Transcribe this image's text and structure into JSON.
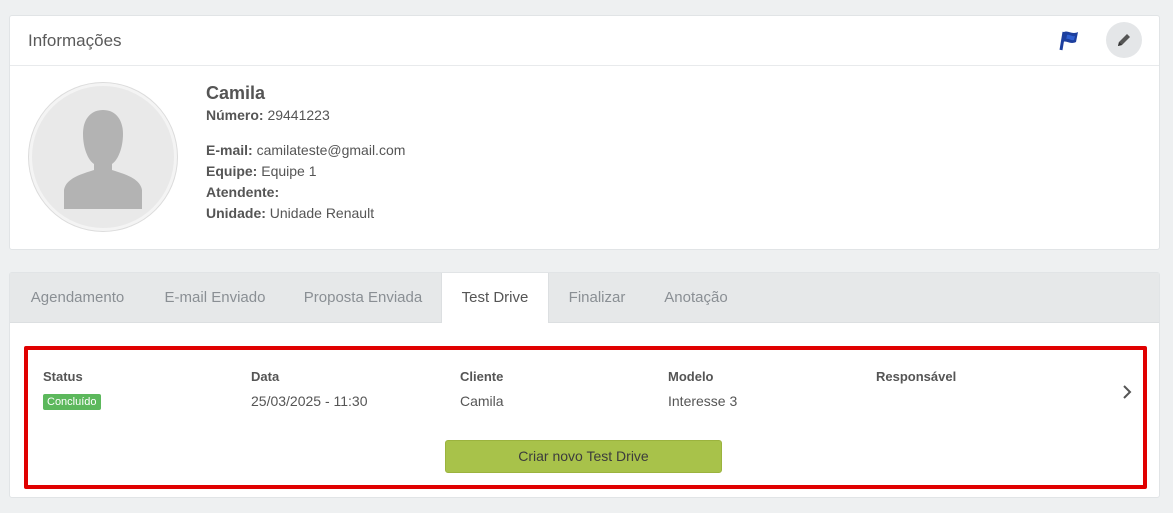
{
  "info": {
    "title": "Informações",
    "icons": {
      "flag": "flag-icon",
      "edit": "pencil-icon"
    },
    "name": "Camila",
    "fields": {
      "numero_label": "Número:",
      "numero_value": "29441223",
      "email_label": "E-mail:",
      "email_value": "camilateste@gmail.com",
      "equipe_label": "Equipe:",
      "equipe_value": "Equipe 1",
      "atendente_label": "Atendente:",
      "atendente_value": "",
      "unidade_label": "Unidade:",
      "unidade_value": "Unidade Renault"
    }
  },
  "tabs": [
    {
      "label": "Agendamento"
    },
    {
      "label": "E-mail Enviado"
    },
    {
      "label": "Proposta Enviada"
    },
    {
      "label": "Test Drive",
      "active": true
    },
    {
      "label": "Finalizar"
    },
    {
      "label": "Anotação"
    }
  ],
  "test_drive": {
    "columns": {
      "status": "Status",
      "data": "Data",
      "cliente": "Cliente",
      "modelo": "Modelo",
      "responsavel": "Responsável"
    },
    "row": {
      "status": "Concluído",
      "data": "25/03/2025 - 11:30",
      "cliente": "Camila",
      "modelo": "Interesse 3",
      "responsavel": ""
    },
    "create_button": "Criar novo Test Drive",
    "chevron_icon": "chevron-right-icon"
  },
  "colors": {
    "badge_success": "#5cb85c",
    "create_button": "#a8c24a",
    "highlight_border": "#e00000",
    "flag_blue": "#1d3f9e"
  }
}
